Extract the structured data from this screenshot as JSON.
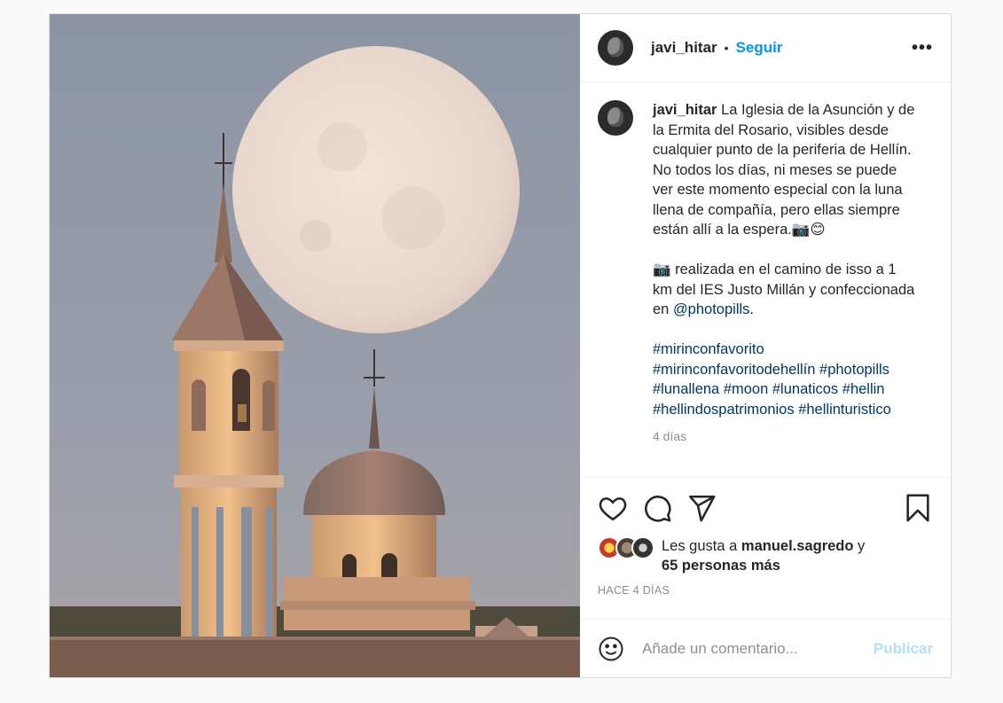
{
  "post": {
    "username": "javi_hitar",
    "dot": "•",
    "follow_label": "Seguir",
    "more_label": "•••",
    "caption": {
      "username": "javi_hitar",
      "line1": "La Iglesia de la Asunción y de la Ermita del Rosario, visibles desde cualquier punto de la periferia de Hellín. No todos los días, ni meses se puede ver este momento especial con la luna llena de compañía, pero ellas siempre están allí a la espera.📷😊",
      "line2_prefix": "📷 realizada en el camino de isso a 1 km del IES Justo Millán y confeccionada en ",
      "mention": "@photopills",
      "line2_suffix": ".",
      "hashtags": [
        "#mirinconfavorito",
        "#mirinconfavoritodehellín",
        "#photopills",
        "#lunallena",
        "#moon",
        "#lunaticos",
        "#hellin",
        "#hellindospatrimonios",
        "#hellinturistico"
      ],
      "time": "4 días"
    },
    "likes": {
      "prefix": "Les gusta a ",
      "user": "manuel.sagredo",
      "mid": " y",
      "others": "65 personas más"
    },
    "posted_ago": "HACE 4 DÍAS",
    "comment_placeholder": "Añade un comentario...",
    "publish_label": "Publicar"
  },
  "icons": {
    "like": "heart-icon",
    "comment": "comment-icon",
    "share": "paper-plane-icon",
    "save": "bookmark-icon",
    "emoji": "smiley-icon"
  },
  "colors": {
    "accent": "#0095f6",
    "link": "#00376b",
    "muted": "#8e8e8e",
    "publish_disabled": "#b2dffc"
  }
}
